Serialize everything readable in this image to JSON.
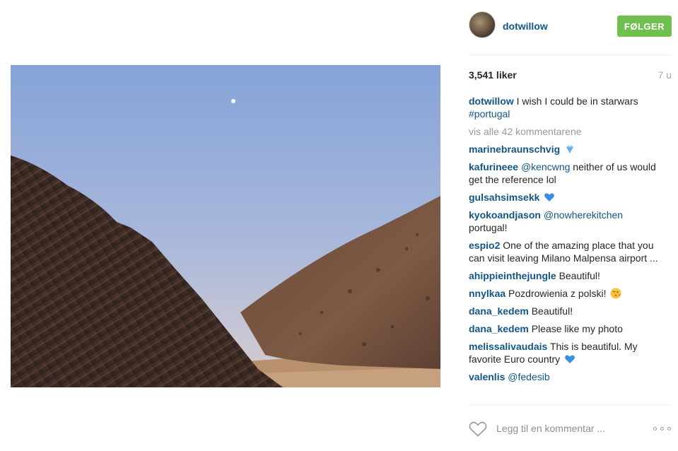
{
  "post": {
    "username": "dotwillow",
    "follow_label": "FØLGER",
    "likes": "3,541 liker",
    "time_ago": "7 u",
    "caption": {
      "user": "dotwillow",
      "text": "I wish I could be in starwars",
      "hashtag": "#portugal"
    },
    "view_all": "vis alle 42 kommentarene",
    "comment_placeholder": "Legg til en kommentar ..."
  },
  "comments": [
    {
      "user": "marinebraunschvig",
      "mention": "",
      "text": "",
      "emoji": "gem-icon"
    },
    {
      "user": "kafurineee",
      "mention": "@kencwng",
      "text": "neither of us would get the reference lol",
      "emoji": ""
    },
    {
      "user": "gulsahsimsekk",
      "mention": "",
      "text": "",
      "emoji": "blue-heart-icon"
    },
    {
      "user": "kyokoandjason",
      "mention": "@nowherekitchen",
      "text": "portugal!",
      "emoji": ""
    },
    {
      "user": "espio2",
      "mention": "",
      "text": "One of the amazing place that you can visit leaving Milano Malpensa airport ...",
      "emoji": ""
    },
    {
      "user": "ahippieinthejungle",
      "mention": "",
      "text": "Beautiful!",
      "emoji": ""
    },
    {
      "user": "nnylkaa",
      "mention": "",
      "text": "Pozdrowienia z polski!",
      "emoji": "kiss-face-icon"
    },
    {
      "user": "dana_kedem",
      "mention": "",
      "text": "Beautiful!",
      "emoji": ""
    },
    {
      "user": "dana_kedem",
      "mention": "",
      "text": "Please like my photo",
      "emoji": ""
    },
    {
      "user": "melissalivaudais",
      "mention": "",
      "text": "This is beautiful. My favorite Euro country",
      "emoji": "blue-heart-icon"
    },
    {
      "user": "valenlis",
      "mention": "@fedesib",
      "text": "",
      "emoji": ""
    }
  ],
  "colors": {
    "username": "#125688",
    "follow_bg": "#70c050",
    "muted": "#999999"
  }
}
